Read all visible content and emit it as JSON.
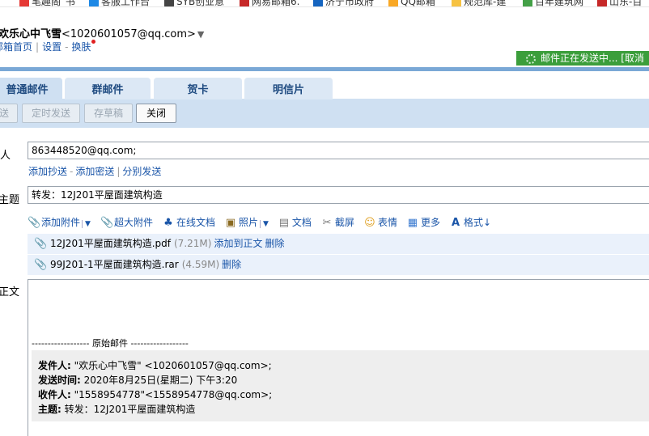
{
  "bookmarks": [
    {
      "label": "笔趣阁_书",
      "color": "#e53935"
    },
    {
      "label": "客服工作台",
      "color": "#1e88e5"
    },
    {
      "label": "SYB创业意",
      "color": "#444444"
    },
    {
      "label": "网易邮箱6.",
      "color": "#c62828"
    },
    {
      "label": "济宁市政府",
      "color": "#1565c0"
    },
    {
      "label": "QQ邮箱",
      "color": "#f9a825"
    },
    {
      "label": "规范库-建",
      "color": "#f6c242"
    },
    {
      "label": "百年建筑网",
      "color": "#43a047"
    },
    {
      "label": "山东-百",
      "color": "#c62828"
    }
  ],
  "header": {
    "nickname": "欢乐心中飞雪",
    "email": "<1020601057@qq.com>",
    "dropdown_arrow": "▼",
    "links": [
      "邮箱首页",
      "设置",
      "换肤"
    ],
    "link_sep_1": "|",
    "link_sep_2": "-",
    "sending_status": "邮件正在发送中...  [取消"
  },
  "tabs": [
    "普通邮件",
    "群邮件",
    "贺卡",
    "明信片"
  ],
  "actions": {
    "send": "发送",
    "schedule": "定时发送",
    "draft": "存草稿",
    "close": "关闭"
  },
  "compose": {
    "to_label": "收件人",
    "to_value": "863448520@qq.com;",
    "cc_links": [
      "添加抄送",
      "添加密送",
      "分别发送"
    ],
    "cc_sep_1": "-",
    "cc_sep_2": "|",
    "subject_label": "主题",
    "subject_value": "转发：12J201平屋面建筑构造",
    "body_label": "正文"
  },
  "toolbar": [
    {
      "label": "添加附件",
      "icon": "paperclip-icon",
      "glyph": "✎",
      "dropdown": true
    },
    {
      "label": "超大附件",
      "icon": "big-attachment-icon",
      "glyph": "✎",
      "dropdown": false
    },
    {
      "label": "在线文档",
      "icon": "online-doc-icon",
      "glyph": "♣",
      "dropdown": false
    },
    {
      "label": "照片",
      "icon": "photo-icon",
      "glyph": "▣",
      "dropdown": true
    },
    {
      "label": "文档",
      "icon": "document-icon",
      "glyph": "▤",
      "dropdown": false
    },
    {
      "label": "截屏",
      "icon": "screenshot-icon",
      "glyph": "✂",
      "dropdown": false
    },
    {
      "label": "表情",
      "icon": "emoji-icon",
      "glyph": "☺",
      "dropdown": false
    },
    {
      "label": "更多",
      "icon": "more-icon",
      "glyph": "▦",
      "dropdown": false
    },
    {
      "label": "格式↓",
      "icon": "format-icon",
      "glyph": "A",
      "dropdown": false
    }
  ],
  "attachments": [
    {
      "name": "12J201平屋面建筑构造.pdf",
      "size": "(7.21M)",
      "add_to_body": "添加到正文",
      "delete": "删除"
    },
    {
      "name": "99J201-1平屋面建筑构造.rar",
      "size": "(4.59M)",
      "add_to_body": null,
      "delete": "删除"
    }
  ],
  "original": {
    "separator": "------------------ 原始邮件 ------------------",
    "from_label": "发件人:",
    "from_value": "\"欢乐心中飞雪\" <1020601057@qq.com>;",
    "time_label": "发送时间:",
    "time_value": "2020年8月25日(星期二) 下午3:20",
    "to_label": "收件人:",
    "to_value": "\"1558954778\"<1558954778@qq.com>;",
    "subject_label": "主题:",
    "subject_value": "转发：12J201平屋面建筑构造"
  }
}
